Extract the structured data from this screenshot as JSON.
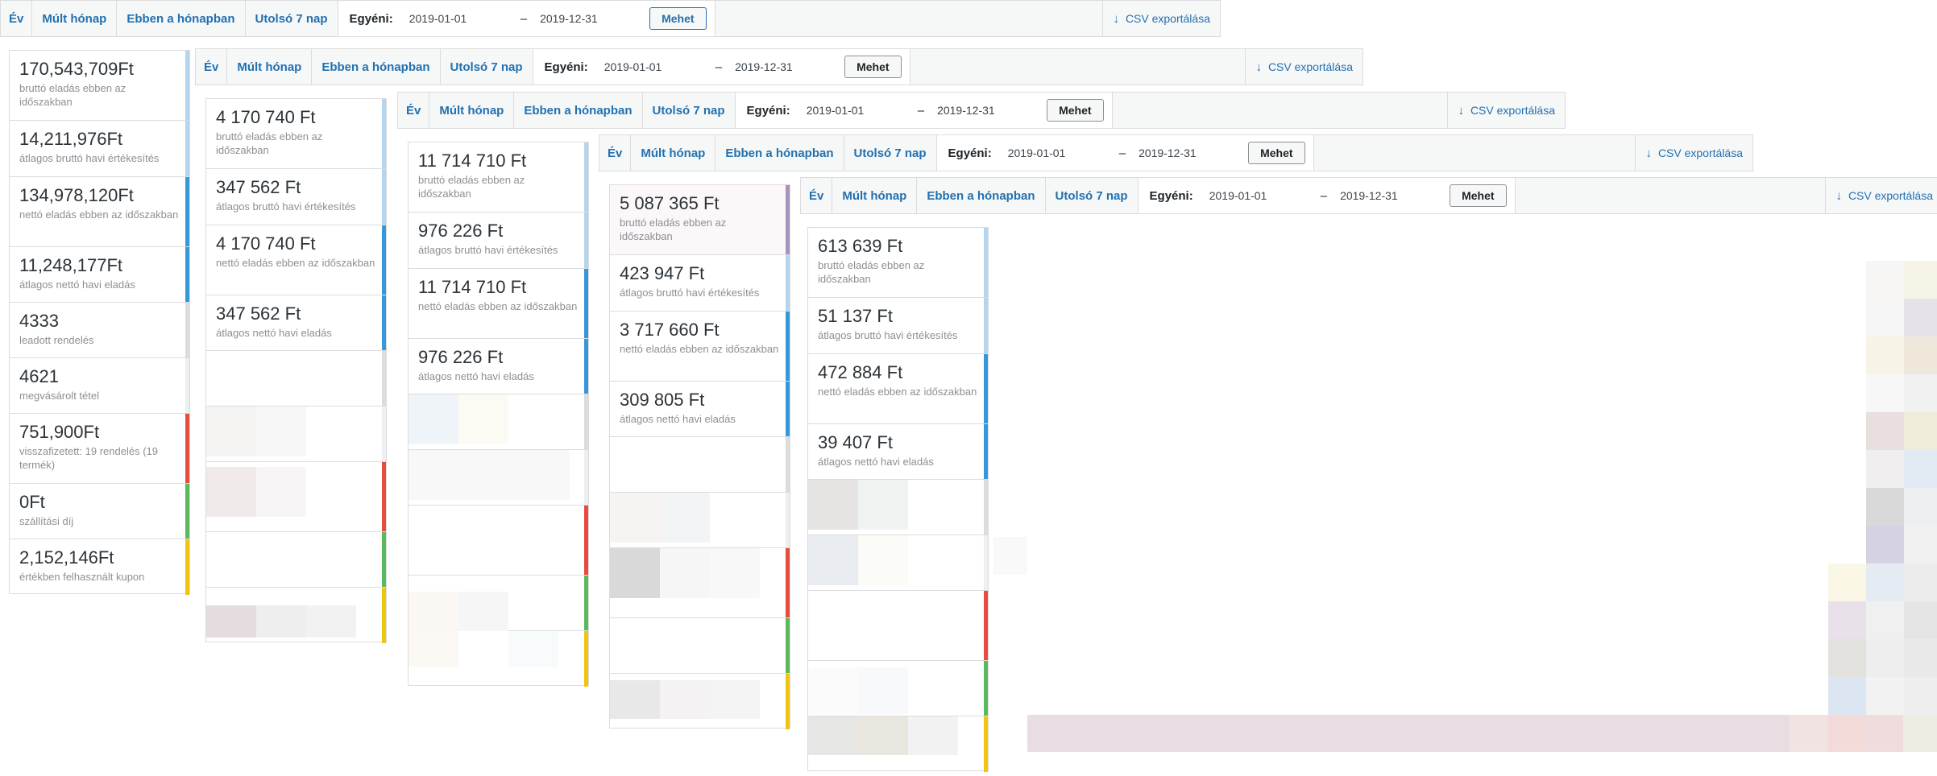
{
  "filter": {
    "tabs": [
      "Év",
      "Múlt hónap",
      "Ebben a hónapban",
      "Utolsó 7 nap"
    ],
    "custom_label": "Egyéni:",
    "date_from": "2019-01-01",
    "date_separator": "–",
    "date_to": "2019-12-31",
    "go_label": "Mehet",
    "export_label": "CSV exportálása"
  },
  "colors": {
    "link": "#2271b1",
    "bar_lightblue": "#b4d5ee",
    "bar_blue": "#3498db",
    "bar_grey": "#dcdcde",
    "bar_red": "#e74c3c",
    "bar_green": "#5cb85c",
    "bar_yellow": "#f1c40f",
    "bar_purple": "#a793bd"
  },
  "panels": [
    {
      "stats": [
        {
          "value": "170,543,709Ft",
          "desc": "bruttó eladás ebben az időszakban"
        },
        {
          "value": "14,211,976Ft",
          "desc": "átlagos bruttó havi értékesítés"
        },
        {
          "value": "134,978,120Ft",
          "desc": "nettó eladás ebben az időszakban"
        },
        {
          "value": "11,248,177Ft",
          "desc": "átlagos nettó havi eladás"
        },
        {
          "value": "4333",
          "desc": "leadott rendelés"
        },
        {
          "value": "4621",
          "desc": "megvásárolt tétel"
        },
        {
          "value": "751,900Ft",
          "desc": "visszafizetett: 19 rendelés (19 termék)"
        },
        {
          "value": "0Ft",
          "desc": "szállítási díj"
        },
        {
          "value": "2,152,146Ft",
          "desc": "értékben felhasznált kupon"
        }
      ]
    },
    {
      "stats": [
        {
          "value": "4 170 740 Ft",
          "desc": "bruttó eladás ebben az időszakban"
        },
        {
          "value": "347 562 Ft",
          "desc": "átlagos bruttó havi értékesítés"
        },
        {
          "value": "4 170 740 Ft",
          "desc": "nettó eladás ebben az időszakban"
        },
        {
          "value": "347 562 Ft",
          "desc": "átlagos nettó havi eladás"
        }
      ]
    },
    {
      "stats": [
        {
          "value": "11 714 710 Ft",
          "desc": "bruttó eladás ebben az időszakban"
        },
        {
          "value": "976 226 Ft",
          "desc": "átlagos bruttó havi értékesítés"
        },
        {
          "value": "11 714 710 Ft",
          "desc": "nettó eladás ebben az időszakban"
        },
        {
          "value": "976 226 Ft",
          "desc": "átlagos nettó havi eladás"
        }
      ]
    },
    {
      "stats": [
        {
          "value": "5 087 365 Ft",
          "desc": "bruttó eladás ebben az időszakban"
        },
        {
          "value": "423 947 Ft",
          "desc": "átlagos bruttó havi értékesítés"
        },
        {
          "value": "3 717 660 Ft",
          "desc": "nettó eladás ebben az időszakban"
        },
        {
          "value": "309 805 Ft",
          "desc": "átlagos nettó havi eladás"
        }
      ]
    },
    {
      "stats": [
        {
          "value": "613 639 Ft",
          "desc": "bruttó eladás ebben az időszakban"
        },
        {
          "value": "51 137 Ft",
          "desc": "átlagos bruttó havi értékesítés"
        },
        {
          "value": "472 884 Ft",
          "desc": "nettó eladás ebben az időszakban"
        },
        {
          "value": "39 407 Ft",
          "desc": "átlagos nettó havi eladás"
        }
      ]
    }
  ]
}
